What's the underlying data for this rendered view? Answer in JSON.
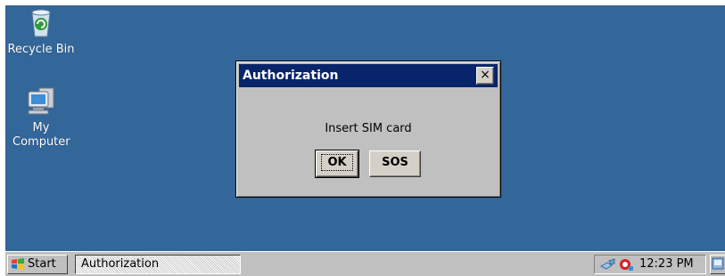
{
  "desktop": {
    "background": "#336699",
    "icons": [
      {
        "label": "Recycle Bin",
        "icon": "recycle-bin-icon"
      },
      {
        "label": "My Computer",
        "icon": "my-computer-icon"
      }
    ]
  },
  "dialog": {
    "title": "Authorization",
    "close_label": "×",
    "message": "Insert SIM card",
    "ok_label": "OK",
    "sos_label": "SOS",
    "title_color": "#08246b"
  },
  "taskbar": {
    "start_label": "Start",
    "task_label": "Authorization",
    "clock": "12:23 PM"
  }
}
